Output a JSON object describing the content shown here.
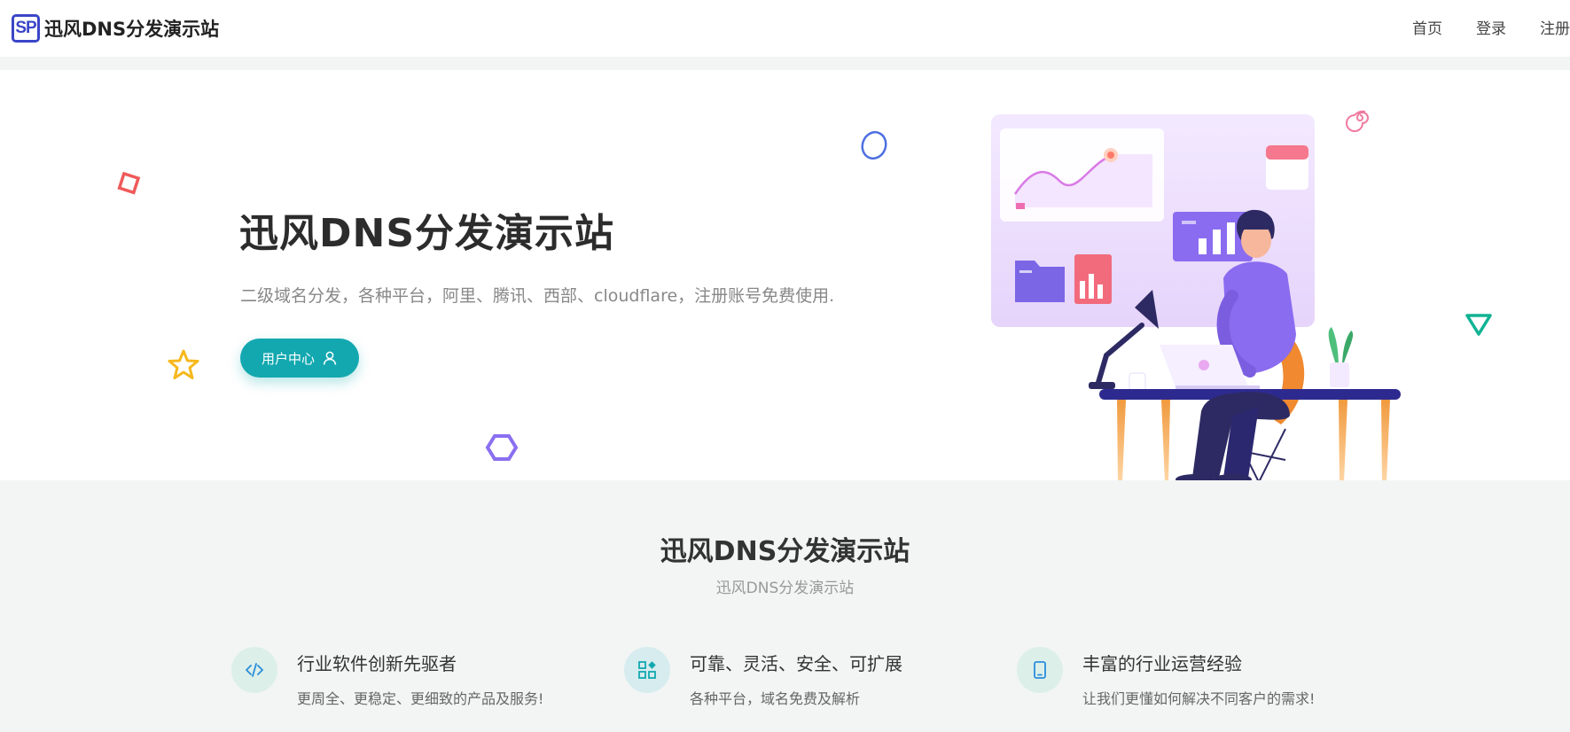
{
  "header": {
    "logo_text": "SP",
    "site_name": "迅风DNS分发演示站",
    "nav": [
      {
        "label": "首页"
      },
      {
        "label": "登录"
      },
      {
        "label": "注册"
      }
    ]
  },
  "hero": {
    "title": "迅风DNS分发演示站",
    "description": "二级域名分发，各种平台，阿里、腾讯、西部、cloudflare，注册账号免费使用.",
    "button_label": "用户中心",
    "button_icon": "user-icon"
  },
  "intro": {
    "title": "迅风DNS分发演示站",
    "subtitle": "迅风DNS分发演示站"
  },
  "features": [
    {
      "icon": "code-icon",
      "title": "行业软件创新先驱者",
      "desc": "更周全、更稳定、更细致的产品及服务!"
    },
    {
      "icon": "apps-icon",
      "title": "可靠、灵活、安全、可扩展",
      "desc": "各种平台，域名免费及解析"
    },
    {
      "icon": "tablet-icon",
      "title": "丰富的行业运营经验",
      "desc": "让我们更懂如何解决不同客户的需求!"
    }
  ],
  "colors": {
    "accent": "#13a8b0",
    "logo": "#3b46c8",
    "feature_icon_bg": "#dcefe9",
    "feature_icon_bg_alt": "#d6ecee"
  }
}
